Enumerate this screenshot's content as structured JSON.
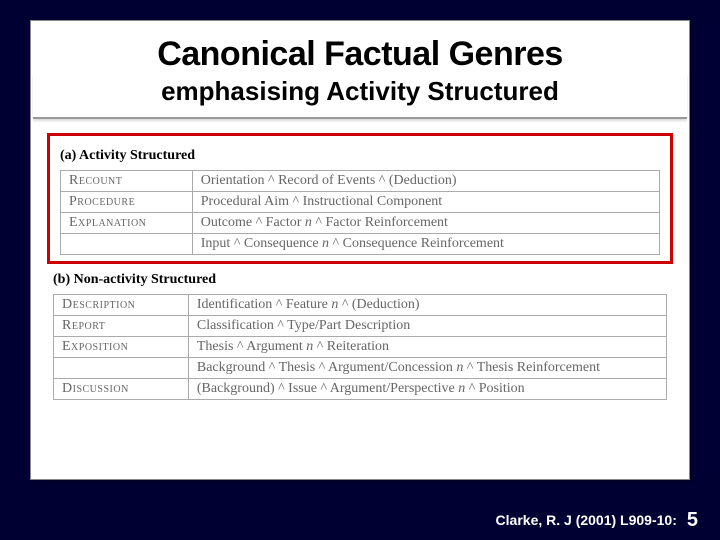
{
  "title": "Canonical Factual Genres",
  "subtitle": "emphasising Activity Structured",
  "section_a": {
    "label": "(a) Activity Structured",
    "rows": [
      {
        "name": "Recount",
        "structure": "Orientation ^ Record of Events ^ (Deduction)"
      },
      {
        "name": "Procedure",
        "structure": "Procedural Aim ^ Instructional Component"
      },
      {
        "name": "Explanation",
        "structure": "Outcome ^ Factor n ^ Factor Reinforcement"
      },
      {
        "name": "",
        "structure": "Input ^ Consequence n ^ Consequence Reinforcement"
      }
    ]
  },
  "section_b": {
    "label": "(b) Non-activity Structured",
    "rows": [
      {
        "name": "Description",
        "structure": "Identification ^ Feature n ^ (Deduction)"
      },
      {
        "name": "Report",
        "structure": "Classification ^ Type/Part Description"
      },
      {
        "name": "Exposition",
        "structure": "Thesis ^ Argument n ^ Reiteration"
      },
      {
        "name": "",
        "structure": "Background ^ Thesis ^ Argument/Concession n ^ Thesis Reinforcement"
      },
      {
        "name": "Discussion",
        "structure": "(Background) ^ Issue ^ Argument/Perspective n ^ Position"
      }
    ]
  },
  "footer": {
    "citation": "Clarke, R. J (2001) L909-10:",
    "page": "5"
  }
}
